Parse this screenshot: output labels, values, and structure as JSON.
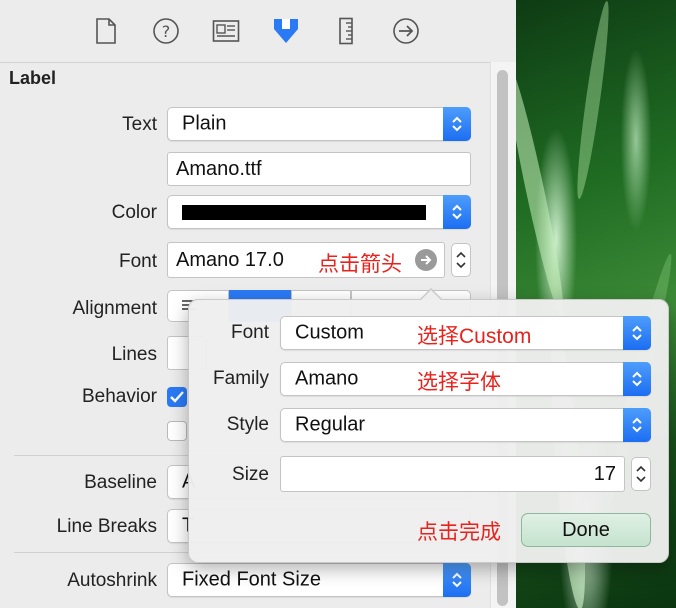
{
  "toolbar": {
    "icons": [
      "file-inspector-icon",
      "quick-help-icon",
      "identity-inspector-icon",
      "attributes-inspector-icon",
      "size-inspector-icon",
      "connections-inspector-icon"
    ]
  },
  "section": {
    "title": "Label"
  },
  "fields": {
    "text_label": "Text",
    "text_value": "Plain",
    "text_content": "Amano.ttf",
    "color_label": "Color",
    "color_value": "#000000",
    "font_label": "Font",
    "font_value": "Amano 17.0",
    "font_annotation": "点击箭头",
    "alignment_label": "Alignment",
    "lines_label": "Lines",
    "behavior_label": "Behavior",
    "baseline_label": "Baseline",
    "baseline_value": "A",
    "line_breaks_label": "Line Breaks",
    "line_breaks_value": "T",
    "autoshrink_label": "Autoshrink",
    "autoshrink_value": "Fixed Font Size"
  },
  "font_popover": {
    "font_label": "Font",
    "font_value": "Custom",
    "font_annotation": "选择Custom",
    "family_label": "Family",
    "family_value": "Amano",
    "family_annotation": "选择字体",
    "style_label": "Style",
    "style_value": "Regular",
    "size_label": "Size",
    "size_value": "17",
    "done_annotation": "点击完成",
    "done_label": "Done"
  },
  "colors": {
    "accent": "#2a7af5",
    "annotation_red": "#e8231d",
    "done_button": "#cfe8d6"
  }
}
